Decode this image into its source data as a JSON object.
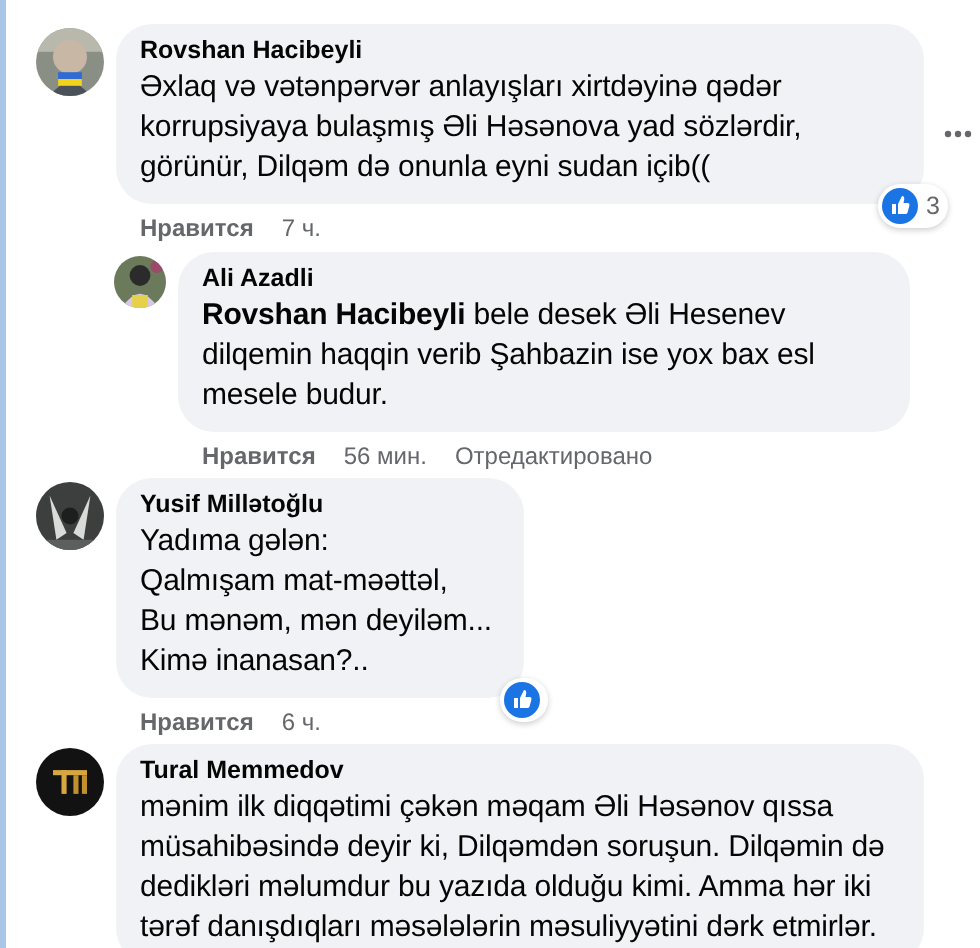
{
  "comments": [
    {
      "author": "Rovshan Hacibeyli",
      "lines": [
        "Əxlaq və vətənpərvər anlayışları xirtdəyinə qədər korrupsiyaya bulaşmış Əli Həsənova yad sözlərdir, görünür, Dilqəm də onunla eyni sudan içib(("
      ],
      "like_label": "Нравится",
      "time": "7 ч.",
      "reaction": {
        "kind": "like",
        "count": "3"
      },
      "menu_visible": true,
      "children": [
        {
          "author": "Ali Azadli",
          "lines": [
            "**Rovshan Hacibeyli** bele desek Əli Hesenev dilqemin haqqin verib Şahbazin ise yox bax esl mesele budur."
          ],
          "like_label": "Нравится",
          "time": "56 мин.",
          "edited_label": "Отредактировано"
        }
      ]
    },
    {
      "author": "Yusif Millətoğlu",
      "lines": [
        "Yadıma gələn:",
        "Qalmışam mat-məəttəl,",
        "Bu mənəm, mən deyiləm...",
        "Kimə inanasan?.."
      ],
      "like_label": "Нравится",
      "time": "6 ч.",
      "reaction": {
        "kind": "like"
      }
    },
    {
      "author": "Tural Memmedov",
      "lines": [
        "mənim ilk diqqətimi çəkən məqam Əli Həsənov qıssa müsahibəsində deyir ki, Dilqəmdən soruşun. Dilqəmin də dedikləri məlumdur bu yazıda olduğu kimi. Amma hər iki tərəf danışdıqları məsələlərin məsuliyyətini dərk etmirlər."
      ]
    }
  ]
}
